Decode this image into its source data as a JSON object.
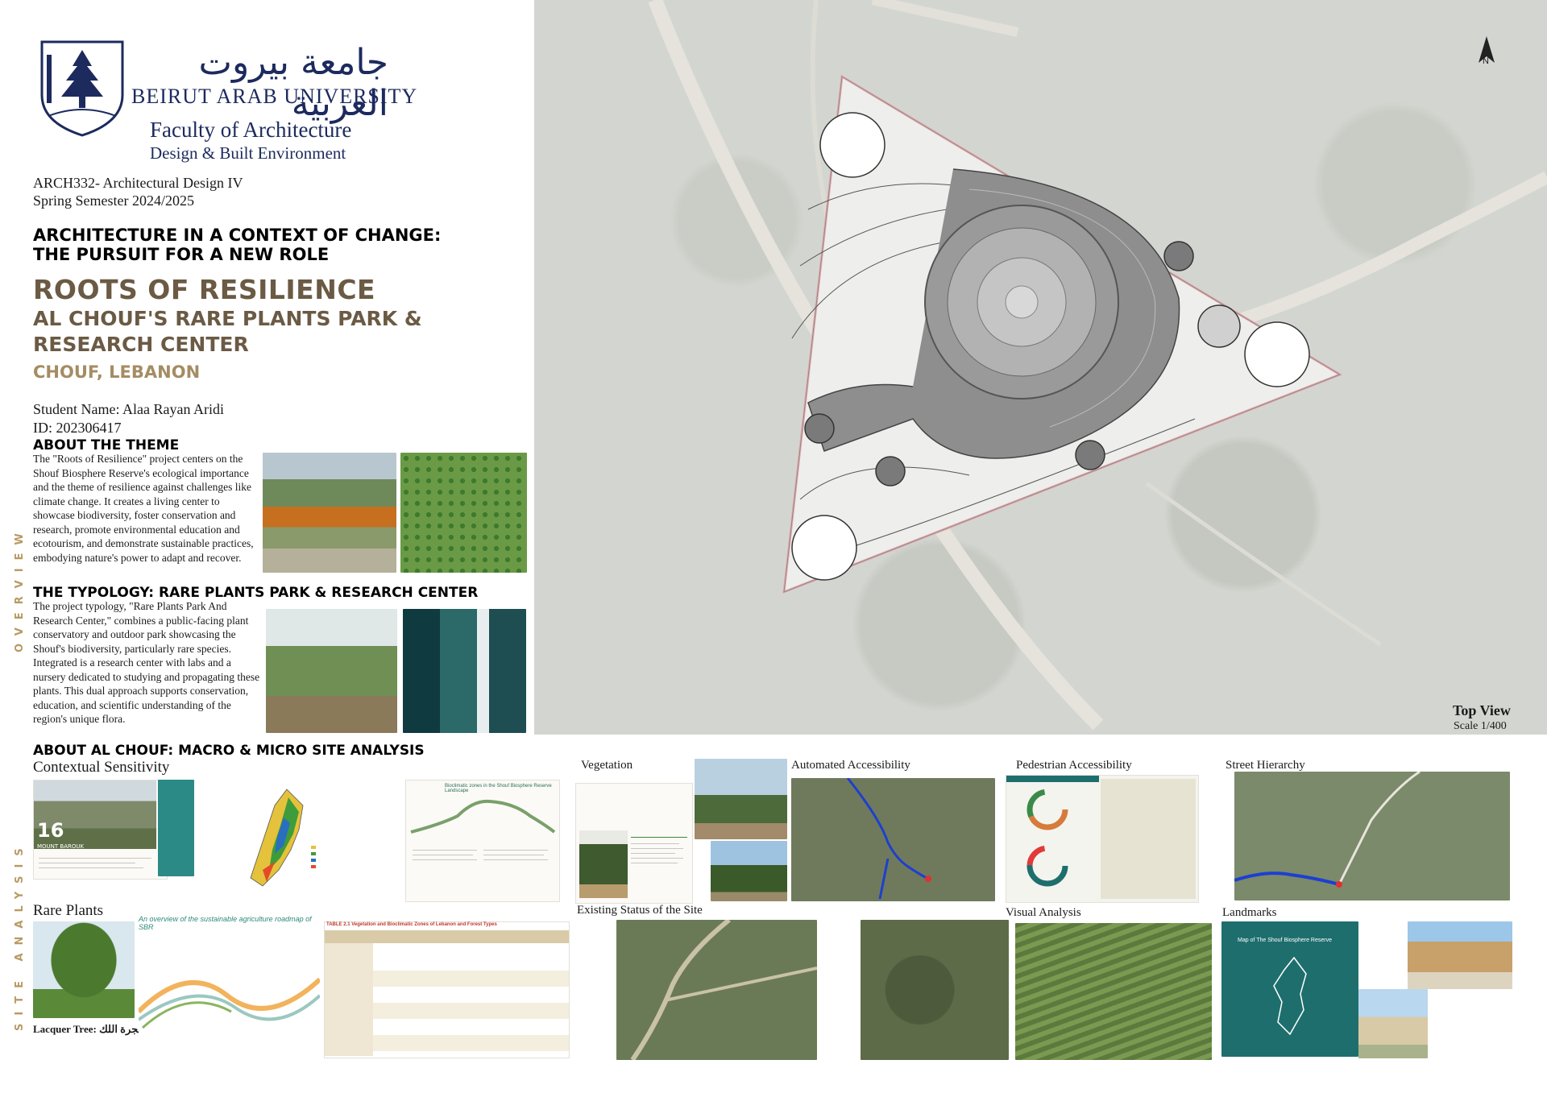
{
  "header": {
    "arabic_name": "جامعة بيروت العربية",
    "university": "BEIRUT ARAB UNIVERSITY",
    "faculty": "Faculty of Architecture",
    "faculty_sub": "Design & Built Environment",
    "course": "ARCH332- Architectural Design IV",
    "semester": "Spring Semester 2024/2025"
  },
  "titles": {
    "theme_line1": "ARCHITECTURE IN A CONTEXT OF CHANGE:",
    "theme_line2": "THE PURSUIT FOR A NEW ROLE",
    "project": "ROOTS OF RESILIENCE",
    "subtitle_line1": "AL CHOUF'S RARE PLANTS PARK &",
    "subtitle_line2": "RESEARCH CENTER",
    "location": "CHOUF, LEBANON"
  },
  "student": {
    "name": "Student Name: Alaa Rayan Aridi",
    "id": "ID: 202306417"
  },
  "overview": {
    "side_label": "OVERVIEW",
    "about_heading": "ABOUT THE THEME",
    "about_text": "The \"Roots of Resilience\" project centers on the Shouf Biosphere Reserve's ecological importance and the theme of resilience against challenges like climate change. It creates a living center to showcase biodiversity, foster conservation and research, promote environmental education and ecotourism, and demonstrate sustainable practices, embodying nature's power to adapt and recover.",
    "typology_heading": "THE TYPOLOGY: RARE PLANTS PARK & RESEARCH CENTER",
    "typology_text": "The project typology, \"Rare Plants Park And Research Center,\" combines a public-facing plant conservatory and outdoor park showcasing the Shouf's biodiversity, particularly rare species. Integrated is a research center with labs and a nursery dedicated to studying and propagating these plants. This dual approach supports conservation, education, and scientific understanding of the region's unique flora."
  },
  "site": {
    "side_label": "SITE ANALYSIS",
    "heading": "ABOUT AL CHOUF: MACRO & MICRO SITE ANALYSIS",
    "contextual": "Contextual Sensitivity",
    "rare_plants": "Rare Plants",
    "lacquer_caption": "Lacquer Tree: شجرة اللك",
    "vegetation": "Vegetation",
    "automated": "Automated Accessibility",
    "pedestrian": "Pedestrian Accessibility",
    "street": "Street Hierarchy",
    "existing": "Existing Status of the Site",
    "visual": "Visual Analysis",
    "landmarks": "Landmarks",
    "mount_number": "16",
    "mount_name": "MOUNT BAROUK",
    "sbr_map_title": "Map of The Shouf Biosphere Reserve",
    "roadmap_title": "An overview of the sustainable agriculture roadmap of SBR",
    "table_title": "TABLE 2.1 Vegetation and Bioclimatic Zones of Lebanon and Forest Types",
    "bioclimatic_title": "Bioclimatic zones in the Shouf Biosphere Reserve Landscape"
  },
  "plan": {
    "north": "N",
    "top_view": "Top View",
    "scale": "Scale 1/400"
  },
  "colors": {
    "navy": "#1c2a5e",
    "brown": "#6b5a44",
    "tan": "#a48c63",
    "teal": "#1f6e6e"
  }
}
